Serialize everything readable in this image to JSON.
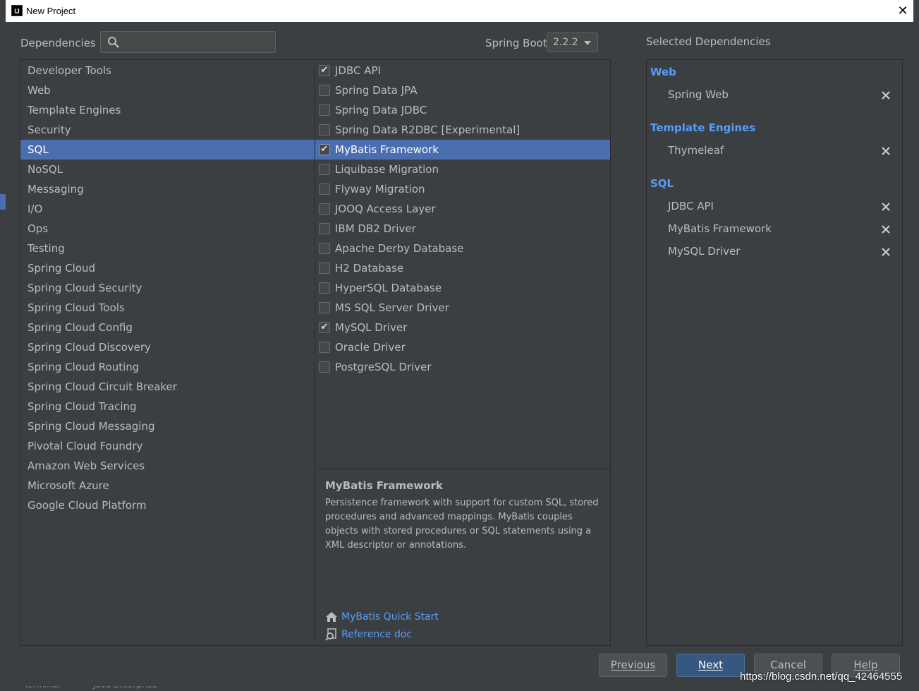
{
  "window": {
    "title": "New Project",
    "close_glyph": "✕"
  },
  "header": {
    "dependencies_label": "Dependencies",
    "search_value": "",
    "spring_boot_label": "Spring Boot",
    "spring_boot_version": "2.2.2",
    "selected_label": "Selected Dependencies"
  },
  "categories": [
    "Developer Tools",
    "Web",
    "Template Engines",
    "Security",
    "SQL",
    "NoSQL",
    "Messaging",
    "I/O",
    "Ops",
    "Testing",
    "Spring Cloud",
    "Spring Cloud Security",
    "Spring Cloud Tools",
    "Spring Cloud Config",
    "Spring Cloud Discovery",
    "Spring Cloud Routing",
    "Spring Cloud Circuit Breaker",
    "Spring Cloud Tracing",
    "Spring Cloud Messaging",
    "Pivotal Cloud Foundry",
    "Amazon Web Services",
    "Microsoft Azure",
    "Google Cloud Platform"
  ],
  "selected_category": "SQL",
  "dependencies": [
    {
      "label": "JDBC API",
      "checked": true
    },
    {
      "label": "Spring Data JPA",
      "checked": false
    },
    {
      "label": "Spring Data JDBC",
      "checked": false
    },
    {
      "label": "Spring Data R2DBC [Experimental]",
      "checked": false
    },
    {
      "label": "MyBatis Framework",
      "checked": true,
      "selected": true
    },
    {
      "label": "Liquibase Migration",
      "checked": false
    },
    {
      "label": "Flyway Migration",
      "checked": false
    },
    {
      "label": "JOOQ Access Layer",
      "checked": false
    },
    {
      "label": "IBM DB2 Driver",
      "checked": false
    },
    {
      "label": "Apache Derby Database",
      "checked": false
    },
    {
      "label": "H2 Database",
      "checked": false
    },
    {
      "label": "HyperSQL Database",
      "checked": false
    },
    {
      "label": "MS SQL Server Driver",
      "checked": false
    },
    {
      "label": "MySQL Driver",
      "checked": true
    },
    {
      "label": "Oracle Driver",
      "checked": false
    },
    {
      "label": "PostgreSQL Driver",
      "checked": false
    }
  ],
  "description": {
    "title": "MyBatis Framework",
    "text": "Persistence framework with support for custom SQL, stored procedures and advanced mappings. MyBatis couples objects with stored procedures or SQL statements using a XML descriptor or annotations.",
    "link_quick_start": "MyBatis Quick Start",
    "link_reference": "Reference doc"
  },
  "selected_groups": [
    {
      "name": "Web",
      "items": [
        "Spring Web"
      ]
    },
    {
      "name": "Template Engines",
      "items": [
        "Thymeleaf"
      ]
    },
    {
      "name": "SQL",
      "items": [
        "JDBC API",
        "MyBatis Framework",
        "MySQL Driver"
      ]
    }
  ],
  "buttons": {
    "previous": "Previous",
    "next": "Next",
    "cancel": "Cancel",
    "help": "Help"
  },
  "background": {
    "terminal": "Terminal",
    "java_enterprise": "Java Enterprise"
  },
  "watermark": "https://blog.csdn.net/qq_42464555",
  "colors": {
    "accent": "#4b6eaf",
    "link": "#589df6",
    "panel": "#3c3f41",
    "primary_button": "#365880"
  }
}
